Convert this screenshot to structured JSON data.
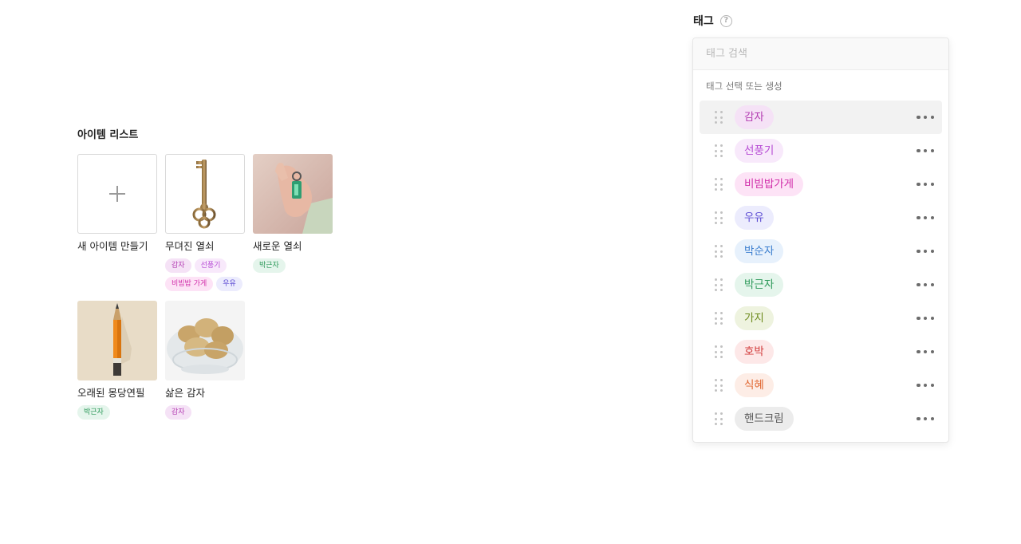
{
  "item_list": {
    "title": "아이템 리스트",
    "new_item_label": "새 아이템 만들기",
    "items": [
      {
        "name": "무뎌진 열쇠",
        "image": "old-key",
        "tags": [
          {
            "label": "감자",
            "color": "gamja"
          },
          {
            "label": "선풍기",
            "color": "fan"
          },
          {
            "label": "비빔밥 가게",
            "color": "bibim"
          },
          {
            "label": "우유",
            "color": "milk"
          }
        ]
      },
      {
        "name": "새로운 열쇠",
        "image": "hand-holding-key",
        "tags": [
          {
            "label": "박근자",
            "color": "bakg"
          }
        ]
      },
      {
        "name": "오래된 몽당연필",
        "image": "pencil-stub",
        "tags": [
          {
            "label": "박근자",
            "color": "bakg"
          }
        ]
      },
      {
        "name": "삶은 감자",
        "image": "boiled-potatoes",
        "tags": [
          {
            "label": "감자",
            "color": "gamja"
          }
        ]
      }
    ]
  },
  "tag_panel": {
    "label": "태그",
    "help_icon": "question-circle-icon",
    "search_placeholder": "태그 검색",
    "hint": "태그 선택 또는 생성",
    "tags": [
      {
        "label": "감자",
        "color": "gamja",
        "active": true
      },
      {
        "label": "선풍기",
        "color": "fan"
      },
      {
        "label": "비빔밥가게",
        "color": "bibim"
      },
      {
        "label": "우유",
        "color": "milk"
      },
      {
        "label": "박순자",
        "color": "bak"
      },
      {
        "label": "박근자",
        "color": "bakg"
      },
      {
        "label": "가지",
        "color": "gaji"
      },
      {
        "label": "호박",
        "color": "hobak"
      },
      {
        "label": "식혜",
        "color": "sikhye"
      },
      {
        "label": "핸드크림",
        "color": "hand"
      }
    ]
  }
}
